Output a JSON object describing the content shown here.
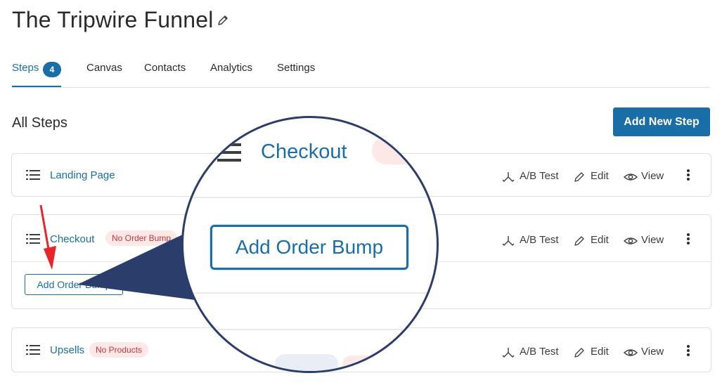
{
  "header": {
    "title": "The Tripwire Funnel",
    "edit_icon": "pencil-icon"
  },
  "tabs": [
    {
      "label": "Steps",
      "count": "4",
      "active": true
    },
    {
      "label": "Canvas"
    },
    {
      "label": "Contacts"
    },
    {
      "label": "Analytics"
    },
    {
      "label": "Settings"
    }
  ],
  "section": {
    "title": "All Steps",
    "add_button": "Add New Step"
  },
  "steps": [
    {
      "name": "Landing Page",
      "badge": "",
      "ab": "A/B Test",
      "edit": "Edit",
      "view": "View"
    },
    {
      "name": "Checkout",
      "badge": "No Order Bump",
      "ab": "A/B Test",
      "edit": "Edit",
      "view": "View",
      "add_bump": "Add Order Bump"
    },
    {
      "name": "Upsells",
      "badge": "No Products",
      "ab": "A/B Test",
      "edit": "Edit",
      "view": "View"
    }
  ],
  "zoom": {
    "step_name": "Checkout",
    "button": "Add Order Bump"
  },
  "colors": {
    "accent": "#1a6ea8",
    "badge_bg": "#fde8e8",
    "badge_text": "#c8363a",
    "arrow": "#e8252a",
    "callout": "#2b3d6b"
  },
  "icons": {
    "drag": "list-icon",
    "ab": "split-icon",
    "edit": "pencil-icon",
    "view": "eye-icon",
    "more": "kebab-icon"
  }
}
